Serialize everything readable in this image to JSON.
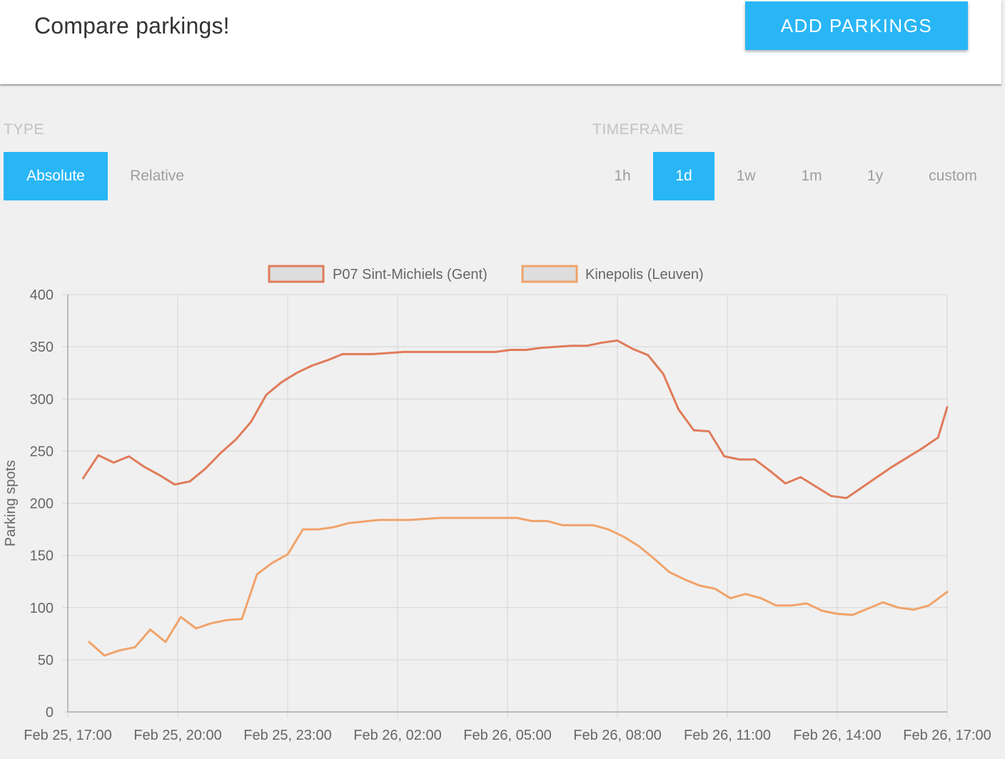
{
  "header": {
    "title": "Compare parkings!",
    "add_button_label": "ADD PARKINGS"
  },
  "type_selector": {
    "label": "TYPE",
    "options": [
      "Absolute",
      "Relative"
    ],
    "selected": "Absolute"
  },
  "timeframe_selector": {
    "label": "TIMEFRAME",
    "options": [
      "1h",
      "1d",
      "1w",
      "1m",
      "1y",
      "custom"
    ],
    "selected": "1d"
  },
  "colors": {
    "accent": "#29b6f6",
    "series_1": "#e07b5a",
    "series_2": "#f0a36a",
    "legend_fill": "#dddddd"
  },
  "chart_data": {
    "type": "line",
    "title": "",
    "xlabel": "",
    "ylabel": "Parking spots",
    "ylim": [
      0,
      400
    ],
    "yticks": [
      0,
      50,
      100,
      150,
      200,
      250,
      300,
      350,
      400
    ],
    "xlim": [
      "Feb 25, 17:00",
      "Feb 26, 17:00"
    ],
    "xticks": [
      "Feb 25, 17:00",
      "Feb 25, 20:00",
      "Feb 25, 23:00",
      "Feb 26, 02:00",
      "Feb 26, 05:00",
      "Feb 26, 08:00",
      "Feb 26, 11:00",
      "Feb 26, 14:00",
      "Feb 26, 17:00"
    ],
    "grid": true,
    "legend_position": "top",
    "series": [
      {
        "name": "P07 Sint-Michiels (Gent)",
        "color": "#e07b5a",
        "points": [
          [
            "Feb 25, 17:25",
            224
          ],
          [
            "Feb 25, 17:50",
            246
          ],
          [
            "Feb 25, 18:15",
            239
          ],
          [
            "Feb 25, 18:40",
            245
          ],
          [
            "Feb 25, 19:05",
            235
          ],
          [
            "Feb 25, 19:30",
            227
          ],
          [
            "Feb 25, 19:55",
            218
          ],
          [
            "Feb 25, 20:20",
            221
          ],
          [
            "Feb 25, 20:45",
            233
          ],
          [
            "Feb 25, 21:10",
            248
          ],
          [
            "Feb 25, 21:35",
            261
          ],
          [
            "Feb 25, 22:00",
            278
          ],
          [
            "Feb 25, 22:25",
            304
          ],
          [
            "Feb 25, 22:50",
            316
          ],
          [
            "Feb 25, 23:15",
            325
          ],
          [
            "Feb 25, 23:40",
            332
          ],
          [
            "Feb 26, 00:05",
            337
          ],
          [
            "Feb 26, 00:30",
            343
          ],
          [
            "Feb 26, 01:20",
            343
          ],
          [
            "Feb 26, 02:10",
            345
          ],
          [
            "Feb 26, 03:00",
            345
          ],
          [
            "Feb 26, 03:50",
            345
          ],
          [
            "Feb 26, 04:40",
            345
          ],
          [
            "Feb 26, 05:05",
            347
          ],
          [
            "Feb 26, 05:30",
            347
          ],
          [
            "Feb 26, 05:55",
            349
          ],
          [
            "Feb 26, 06:20",
            350
          ],
          [
            "Feb 26, 06:45",
            351
          ],
          [
            "Feb 26, 07:10",
            351
          ],
          [
            "Feb 26, 07:35",
            354
          ],
          [
            "Feb 26, 08:00",
            356
          ],
          [
            "Feb 26, 08:25",
            348
          ],
          [
            "Feb 26, 08:50",
            342
          ],
          [
            "Feb 26, 09:15",
            324
          ],
          [
            "Feb 26, 09:40",
            290
          ],
          [
            "Feb 26, 10:05",
            270
          ],
          [
            "Feb 26, 10:30",
            269
          ],
          [
            "Feb 26, 10:55",
            245
          ],
          [
            "Feb 26, 11:20",
            242
          ],
          [
            "Feb 26, 11:45",
            242
          ],
          [
            "Feb 26, 12:10",
            231
          ],
          [
            "Feb 26, 12:35",
            219
          ],
          [
            "Feb 26, 13:00",
            225
          ],
          [
            "Feb 26, 13:25",
            216
          ],
          [
            "Feb 26, 13:50",
            207
          ],
          [
            "Feb 26, 14:15",
            205
          ],
          [
            "Feb 26, 14:40",
            215
          ],
          [
            "Feb 26, 15:05",
            225
          ],
          [
            "Feb 26, 15:30",
            235
          ],
          [
            "Feb 26, 15:55",
            244
          ],
          [
            "Feb 26, 16:20",
            253
          ],
          [
            "Feb 26, 16:45",
            263
          ],
          [
            "Feb 26, 17:00",
            292
          ]
        ]
      },
      {
        "name": "Kinepolis (Leuven)",
        "color": "#f0a36a",
        "points": [
          [
            "Feb 25, 17:35",
            67
          ],
          [
            "Feb 25, 18:00",
            54
          ],
          [
            "Feb 25, 18:25",
            59
          ],
          [
            "Feb 25, 18:50",
            62
          ],
          [
            "Feb 25, 19:15",
            79
          ],
          [
            "Feb 25, 19:40",
            67
          ],
          [
            "Feb 25, 20:05",
            91
          ],
          [
            "Feb 25, 20:30",
            80
          ],
          [
            "Feb 25, 20:55",
            85
          ],
          [
            "Feb 25, 21:20",
            88
          ],
          [
            "Feb 25, 21:45",
            89
          ],
          [
            "Feb 25, 22:10",
            132
          ],
          [
            "Feb 25, 22:35",
            143
          ],
          [
            "Feb 25, 23:00",
            151
          ],
          [
            "Feb 25, 23:25",
            175
          ],
          [
            "Feb 25, 23:50",
            175
          ],
          [
            "Feb 26, 00:15",
            177
          ],
          [
            "Feb 26, 00:40",
            181
          ],
          [
            "Feb 26, 01:30",
            184
          ],
          [
            "Feb 26, 02:20",
            184
          ],
          [
            "Feb 26, 03:10",
            186
          ],
          [
            "Feb 26, 04:00",
            186
          ],
          [
            "Feb 26, 04:50",
            186
          ],
          [
            "Feb 26, 05:15",
            186
          ],
          [
            "Feb 26, 05:40",
            183
          ],
          [
            "Feb 26, 06:05",
            183
          ],
          [
            "Feb 26, 06:30",
            179
          ],
          [
            "Feb 26, 07:20",
            179
          ],
          [
            "Feb 26, 07:45",
            175
          ],
          [
            "Feb 26, 08:10",
            168
          ],
          [
            "Feb 26, 08:35",
            159
          ],
          [
            "Feb 26, 09:00",
            147
          ],
          [
            "Feb 26, 09:25",
            134
          ],
          [
            "Feb 26, 09:50",
            127
          ],
          [
            "Feb 26, 10:15",
            121
          ],
          [
            "Feb 26, 10:40",
            118
          ],
          [
            "Feb 26, 11:05",
            109
          ],
          [
            "Feb 26, 11:30",
            113
          ],
          [
            "Feb 26, 11:55",
            109
          ],
          [
            "Feb 26, 12:20",
            102
          ],
          [
            "Feb 26, 12:45",
            102
          ],
          [
            "Feb 26, 13:10",
            104
          ],
          [
            "Feb 26, 13:35",
            97
          ],
          [
            "Feb 26, 14:00",
            94
          ],
          [
            "Feb 26, 14:25",
            93
          ],
          [
            "Feb 26, 14:50",
            99
          ],
          [
            "Feb 26, 15:15",
            105
          ],
          [
            "Feb 26, 15:40",
            100
          ],
          [
            "Feb 26, 16:05",
            98
          ],
          [
            "Feb 26, 16:30",
            102
          ],
          [
            "Feb 26, 17:00",
            115
          ]
        ]
      }
    ]
  }
}
